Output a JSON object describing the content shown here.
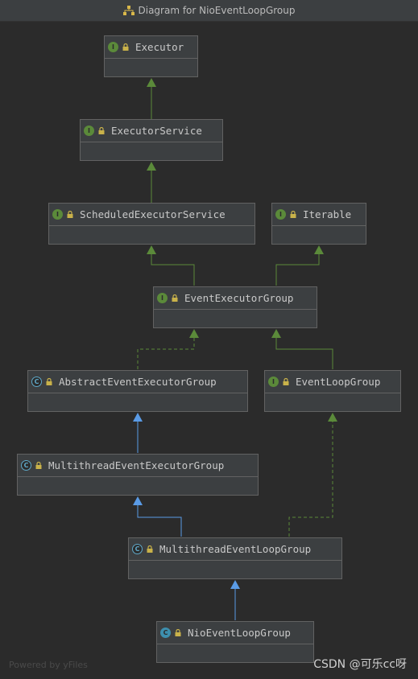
{
  "window": {
    "title": "Diagram for NioEventLoopGroup"
  },
  "nodes": {
    "executor": {
      "name": "Executor",
      "kind": "I"
    },
    "executor_service": {
      "name": "ExecutorService",
      "kind": "I"
    },
    "scheduled_executor_service": {
      "name": "ScheduledExecutorService",
      "kind": "I"
    },
    "iterable": {
      "name": "Iterable",
      "kind": "I"
    },
    "event_executor_group": {
      "name": "EventExecutorGroup",
      "kind": "I"
    },
    "abstract_event_executor_group": {
      "name": "AbstractEventExecutorGroup",
      "kind": "C"
    },
    "event_loop_group": {
      "name": "EventLoopGroup",
      "kind": "I"
    },
    "multithread_event_executor_group": {
      "name": "MultithreadEventExecutorGroup",
      "kind": "C"
    },
    "multithread_event_loop_group": {
      "name": "MultithreadEventLoopGroup",
      "kind": "C"
    },
    "nio_event_loop_group": {
      "name": "NioEventLoopGroup",
      "kind": "C"
    }
  },
  "colors": {
    "background": "#2b2b2b",
    "interface_edge": "#5b8a3a",
    "extends_edge": "#5a9be6",
    "implements_dashed": "#5b8a3a"
  },
  "footer": {
    "powered_by": "Powered by yFiles",
    "watermark": "CSDN @可乐cc呀"
  }
}
